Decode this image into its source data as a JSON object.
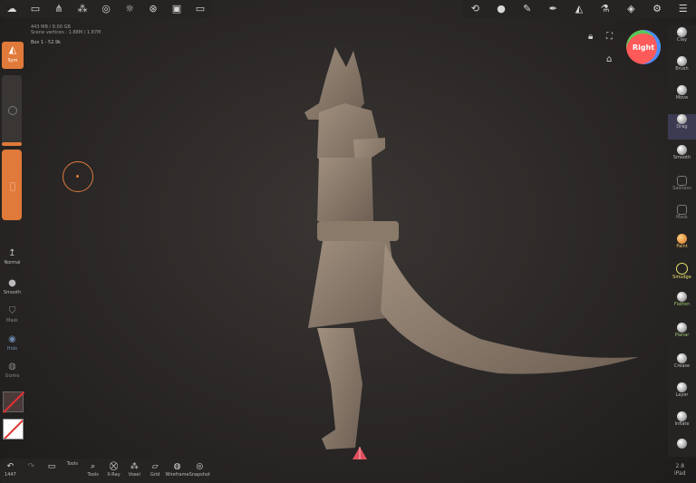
{
  "top_left_icons": [
    "cloud-icon",
    "folder-icon",
    "share-icon",
    "scene-icon",
    "globe-icon",
    "sun-icon",
    "camera-settings-icon",
    "image-icon",
    "video-icon"
  ],
  "top_right_icons": [
    "gallery-icon",
    "material-icon",
    "brush-icon",
    "pen-icon",
    "symmetry-icon",
    "flask-icon",
    "layers-icon",
    "settings-icon",
    "sliders-icon"
  ],
  "stats": {
    "line1": "443 MB / 8.00 GB",
    "line2": "Scene vertices : 1.88M / 1.87M",
    "object": "Box 1 - 52.9k"
  },
  "view_cube": "Right",
  "left_tools": {
    "sym_label": "Sym",
    "normal": "Normal",
    "smooth": "Smooth",
    "mask": "Mask",
    "hide": "Hide",
    "gizmo": "Gizmo"
  },
  "right_tools": [
    "Clay",
    "Brush",
    "Move",
    "Drag",
    "Smooth",
    "Sadness",
    "Mask",
    "Paint",
    "Smudge",
    "Flatten",
    "Planar",
    "Crease",
    "Layer",
    "Inflate"
  ],
  "bottom_tools": [
    "1447",
    "",
    "",
    "Tools",
    "X-Ray",
    "Voxel",
    "Grid",
    "Wireframe",
    "Snapshot"
  ],
  "version": {
    "number": "2.8",
    "device": "iPad"
  },
  "colors": {
    "accent": "#e07a3a",
    "panel": "#262422",
    "model": "#8a7a6a"
  }
}
